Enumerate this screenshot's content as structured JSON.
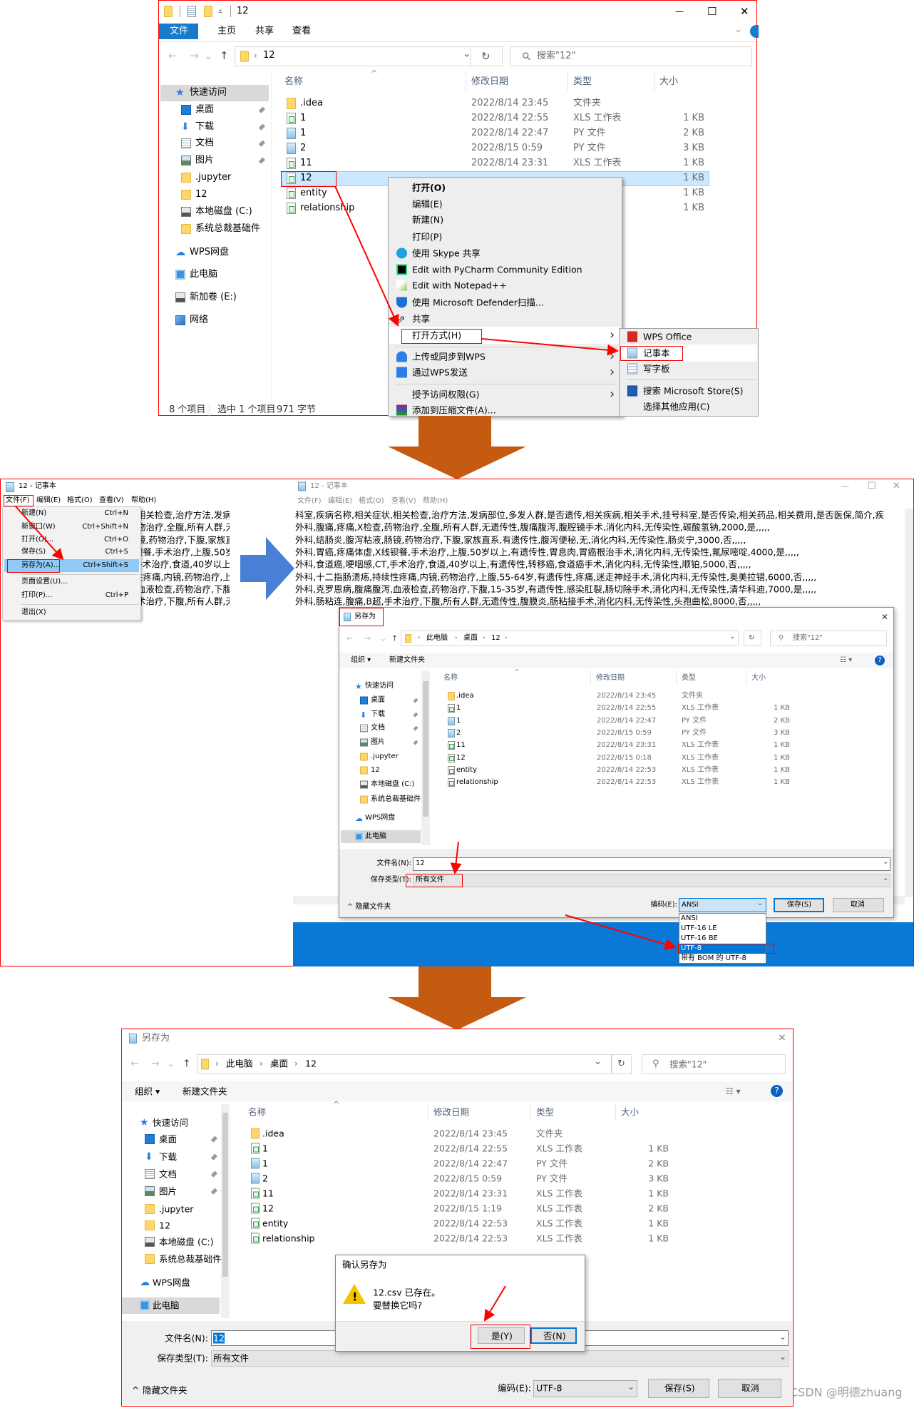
{
  "colors": {
    "annotation_red": "#ff0000",
    "step_arrow": "#c55a11",
    "next_arrow": "#4a7fd6",
    "ribbon_blue": "#1979ca",
    "selection": "#cce8ff",
    "desktop_blue": "#0a78d7"
  },
  "step1": {
    "title": "12",
    "ribbon_tabs": [
      "文件",
      "主页",
      "共享",
      "查看"
    ],
    "address": "12",
    "search_placeholder": "搜索\"12\"",
    "columns": [
      "名称",
      "修改日期",
      "类型",
      "大小"
    ],
    "nav": [
      {
        "label": "快速访问",
        "icon": "star",
        "selected": true
      },
      {
        "label": "桌面",
        "icon": "desktop",
        "child": true,
        "pinned": true
      },
      {
        "label": "下载",
        "icon": "download",
        "child": true,
        "pinned": true
      },
      {
        "label": "文档",
        "icon": "docs",
        "child": true,
        "pinned": true
      },
      {
        "label": "图片",
        "icon": "pictures",
        "child": true,
        "pinned": true
      },
      {
        "label": ".jupyter",
        "icon": "folder",
        "child": true
      },
      {
        "label": "12",
        "icon": "folder",
        "child": true
      },
      {
        "label": "本地磁盘 (C:)",
        "icon": "drive",
        "child": true
      },
      {
        "label": "系统总裁基础件",
        "icon": "folder",
        "child": true
      },
      {
        "label": "WPS网盘",
        "icon": "cloud"
      },
      {
        "label": "此电脑",
        "icon": "pc"
      },
      {
        "label": "新加卷 (E:)",
        "icon": "drive"
      },
      {
        "label": "网络",
        "icon": "network"
      }
    ],
    "files": [
      {
        "name": ".idea",
        "date": "2022/8/14 23:45",
        "type": "文件夹",
        "size": "",
        "icon": "folder"
      },
      {
        "name": "1",
        "date": "2022/8/14 22:55",
        "type": "XLS 工作表",
        "size": "1 KB",
        "icon": "xls"
      },
      {
        "name": "1",
        "date": "2022/8/14 22:47",
        "type": "PY 文件",
        "size": "2 KB",
        "icon": "py"
      },
      {
        "name": "2",
        "date": "2022/8/15 0:59",
        "type": "PY 文件",
        "size": "3 KB",
        "icon": "py"
      },
      {
        "name": "11",
        "date": "2022/8/14 23:31",
        "type": "XLS 工作表",
        "size": "1 KB",
        "icon": "xls"
      },
      {
        "name": "12",
        "date": "",
        "type": "",
        "size": "1 KB",
        "icon": "xls",
        "selected": true
      },
      {
        "name": "entity",
        "date": "",
        "type": "",
        "size": "1 KB",
        "icon": "xls"
      },
      {
        "name": "relationship",
        "date": "",
        "type": "",
        "size": "1 KB",
        "icon": "xls"
      }
    ],
    "status": {
      "count": "8 个项目",
      "selection": "选中 1 个项目",
      "bytes": "971 字节"
    },
    "context_menu": [
      {
        "label": "打开(O)",
        "bold": true
      },
      {
        "label": "编辑(E)"
      },
      {
        "label": "新建(N)"
      },
      {
        "label": "打印(P)"
      },
      {
        "label": "使用 Skype 共享",
        "icon": "skype"
      },
      {
        "label": "Edit with PyCharm Community Edition",
        "icon": "pycharm"
      },
      {
        "label": "Edit with Notepad++",
        "icon": "notepadpp"
      },
      {
        "label": "使用 Microsoft Defender扫描...",
        "icon": "defender"
      },
      {
        "label": "共享",
        "icon": "share"
      },
      {
        "label": "打开方式(H)",
        "submenu": true,
        "highlighted": true
      },
      {
        "separator": true
      },
      {
        "label": "上传或同步到WPS",
        "icon": "wps-cloud",
        "submenu": true
      },
      {
        "label": "通过WPS发送",
        "icon": "wps-send",
        "submenu": true
      },
      {
        "separator": true
      },
      {
        "label": "授予访问权限(G)",
        "submenu": true
      },
      {
        "label": "添加到压缩文件(A)...",
        "icon": "winrar"
      }
    ],
    "open_with": [
      {
        "label": "WPS Office",
        "icon": "wps-office"
      },
      {
        "label": "记事本",
        "icon": "notepad",
        "highlighted": true
      },
      {
        "label": "写字板",
        "icon": "wordpad"
      },
      {
        "separator": true
      },
      {
        "label": "搜索 Microsoft Store(S)",
        "icon": "store"
      },
      {
        "label": "选择其他应用(C)"
      }
    ]
  },
  "step2": {
    "notepad_title": "12 - 记事本",
    "menubar": [
      "文件(F)",
      "编辑(E)",
      "格式(O)",
      "查看(V)",
      "帮助(H)"
    ],
    "file_menu": [
      {
        "label": "新建(N)",
        "shortcut": "Ctrl+N"
      },
      {
        "label": "新窗口(W)",
        "shortcut": "Ctrl+Shift+N"
      },
      {
        "label": "打开(O)...",
        "shortcut": "Ctrl+O"
      },
      {
        "label": "保存(S)",
        "shortcut": "Ctrl+S"
      },
      {
        "label": "另存为(A)...",
        "shortcut": "Ctrl+Shift+S",
        "highlighted": true
      },
      {
        "separator": true
      },
      {
        "label": "页面设置(U)...",
        "shortcut": ""
      },
      {
        "label": "打印(P)...",
        "shortcut": "Ctrl+P"
      },
      {
        "separator": true
      },
      {
        "label": "退出(X)",
        "shortcut": ""
      }
    ],
    "text_lines": [
      "科室,疾病名称,相关症状,相关检查,治疗方法,发病部位,多发人群,是否遗传,相关疾病,相关手术,挂号科室,是否传染,相关药品,相关费用,是否医保,简介,疾",
      "外科,腹痛,疼痛,X检查,药物治疗,全腹,所有人群,无遗传性,腹痛腹泻,腹腔镜手术,消化内科,无传染性,碳酸氢钠,2000,是,,,,,",
      "外科,结肠炎,腹泻粘液,肠镜,药物治疗,下腹,家族直系,有遗传性,腹泻便秘,无,消化内科,无传染性,肠炎宁,3000,否,,,,,",
      "外科,胃癌,疼痛体虚,X线钡餐,手术治疗,上腹,50岁以上,有遗传性,胃息肉,胃癌根治手术,消化内科,无传染性,氟尿嘧啶,4000,是,,,,,",
      "外科,食道癌,哽咽感,CT,手术治疗,食道,40岁以上,有遗传性,转移癌,食道癌手术,消化内科,无传染性,顺铂,5000,否,,,,,",
      "外科,十二指肠溃疡,持续性疼痛,内镜,药物治疗,上腹,55-64岁,有遗传性,疼痛,迷走神经手术,消化内科,无传染性,奥美拉错,6000,否,,,,,",
      "外科,克罗恩病,腹痛腹泻,血液检查,药物治疗,下腹,15-35岁,有遗传性,感染肛裂,肠切除手术,消化内科,无传染性,清华科迪,7000,是,,,,,",
      "外科,肠粘连,腹痛,B超,手术治疗,下腹,所有人群,无遗传性,腹膜炎,肠粘接手术,消化内科,无传染性,头孢曲松,8000,否,,,,,"
    ],
    "dialog": {
      "title": "另存为",
      "breadcrumb": [
        "此电脑",
        "桌面",
        "12"
      ],
      "search_placeholder": "搜索\"12\"",
      "toolbar": {
        "organize": "组织 ▾",
        "new_folder": "新建文件夹"
      },
      "columns": [
        "名称",
        "修改日期",
        "类型",
        "大小"
      ],
      "nav": [
        {
          "label": "快速访问",
          "icon": "star"
        },
        {
          "label": "桌面",
          "icon": "desktop",
          "child": true,
          "pinned": true
        },
        {
          "label": "下载",
          "icon": "download",
          "child": true,
          "pinned": true
        },
        {
          "label": "文档",
          "icon": "docs",
          "child": true,
          "pinned": true
        },
        {
          "label": "图片",
          "icon": "pictures",
          "child": true,
          "pinned": true
        },
        {
          "label": ".jupyter",
          "icon": "folder",
          "child": true
        },
        {
          "label": "12",
          "icon": "folder",
          "child": true
        },
        {
          "label": "本地磁盘 (C:)",
          "icon": "drive",
          "child": true
        },
        {
          "label": "系统总裁基础件",
          "icon": "folder",
          "child": true
        },
        {
          "label": "WPS网盘",
          "icon": "cloud"
        },
        {
          "label": "此电脑",
          "icon": "pc",
          "selected": true
        }
      ],
      "files": [
        {
          "name": ".idea",
          "date": "2022/8/14 23:45",
          "type": "文件夹",
          "size": "",
          "icon": "folder"
        },
        {
          "name": "1",
          "date": "2022/8/14 22:55",
          "type": "XLS 工作表",
          "size": "1 KB",
          "icon": "xls"
        },
        {
          "name": "1",
          "date": "2022/8/14 22:47",
          "type": "PY 文件",
          "size": "2 KB",
          "icon": "py"
        },
        {
          "name": "2",
          "date": "2022/8/15 0:59",
          "type": "PY 文件",
          "size": "3 KB",
          "icon": "py"
        },
        {
          "name": "11",
          "date": "2022/8/14 23:31",
          "type": "XLS 工作表",
          "size": "1 KB",
          "icon": "xls"
        },
        {
          "name": "12",
          "date": "2022/8/15 0:18",
          "type": "XLS 工作表",
          "size": "1 KB",
          "icon": "xls"
        },
        {
          "name": "entity",
          "date": "2022/8/14 22:53",
          "type": "XLS 工作表",
          "size": "1 KB",
          "icon": "xls"
        },
        {
          "name": "relationship",
          "date": "2022/8/14 22:53",
          "type": "XLS 工作表",
          "size": "1 KB",
          "icon": "xls"
        }
      ],
      "filename_label": "文件名(N):",
      "filename": "12",
      "filetype_label": "保存类型(T):",
      "filetype": "所有文件",
      "hide_folders": "隐藏文件夹",
      "encoding_label": "编码(E):",
      "encoding": "ANSI",
      "encoding_options": [
        "ANSI",
        "UTF-16 LE",
        "UTF-16 BE",
        "UTF-8",
        "带有 BOM 的 UTF-8"
      ],
      "encoding_highlighted": "UTF-8",
      "save": "保存(S)",
      "cancel": "取消"
    }
  },
  "step3": {
    "title": "另存为",
    "breadcrumb": [
      "此电脑",
      "桌面",
      "12"
    ],
    "search_placeholder": "搜索\"12\"",
    "toolbar": {
      "organize": "组织 ▾",
      "new_folder": "新建文件夹"
    },
    "columns": [
      "名称",
      "修改日期",
      "类型",
      "大小"
    ],
    "nav": [
      {
        "label": "快速访问",
        "icon": "star"
      },
      {
        "label": "桌面",
        "icon": "desktop",
        "child": true,
        "pinned": true
      },
      {
        "label": "下载",
        "icon": "download",
        "child": true,
        "pinned": true
      },
      {
        "label": "文档",
        "icon": "docs",
        "child": true,
        "pinned": true
      },
      {
        "label": "图片",
        "icon": "pictures",
        "child": true,
        "pinned": true
      },
      {
        "label": ".jupyter",
        "icon": "folder",
        "child": true
      },
      {
        "label": "12",
        "icon": "folder",
        "child": true
      },
      {
        "label": "本地磁盘 (C:)",
        "icon": "drive",
        "child": true
      },
      {
        "label": "系统总裁基础件",
        "icon": "folder",
        "child": true
      },
      {
        "label": "WPS网盘",
        "icon": "cloud"
      },
      {
        "label": "此电脑",
        "icon": "pc",
        "selected": true
      }
    ],
    "files": [
      {
        "name": ".idea",
        "date": "2022/8/14 23:45",
        "type": "文件夹",
        "size": "",
        "icon": "folder"
      },
      {
        "name": "1",
        "date": "2022/8/14 22:55",
        "type": "XLS 工作表",
        "size": "1 KB",
        "icon": "xls"
      },
      {
        "name": "1",
        "date": "2022/8/14 22:47",
        "type": "PY 文件",
        "size": "2 KB",
        "icon": "py"
      },
      {
        "name": "2",
        "date": "2022/8/15 0:59",
        "type": "PY 文件",
        "size": "3 KB",
        "icon": "py"
      },
      {
        "name": "11",
        "date": "2022/8/14 23:31",
        "type": "XLS 工作表",
        "size": "1 KB",
        "icon": "xls"
      },
      {
        "name": "12",
        "date": "2022/8/15 1:19",
        "type": "XLS 工作表",
        "size": "2 KB",
        "icon": "xls"
      },
      {
        "name": "entity",
        "date": "2022/8/14 22:53",
        "type": "XLS 工作表",
        "size": "1 KB",
        "icon": "xls"
      },
      {
        "name": "relationship",
        "date": "2022/8/14 22:53",
        "type": "XLS 工作表",
        "size": "1 KB",
        "icon": "xls"
      }
    ],
    "filename_label": "文件名(N):",
    "filename": "12",
    "filetype_label": "保存类型(T):",
    "filetype": "所有文件",
    "hide_folders": "隐藏文件夹",
    "encoding_label": "编码(E):",
    "encoding": "UTF-8",
    "save": "保存(S)",
    "cancel": "取消",
    "confirm": {
      "title": "确认另存为",
      "line1": "12.csv 已存在。",
      "line2": "要替换它吗?",
      "yes": "是(Y)",
      "no": "否(N)"
    }
  },
  "watermark": "CSDN @明德zhuang"
}
